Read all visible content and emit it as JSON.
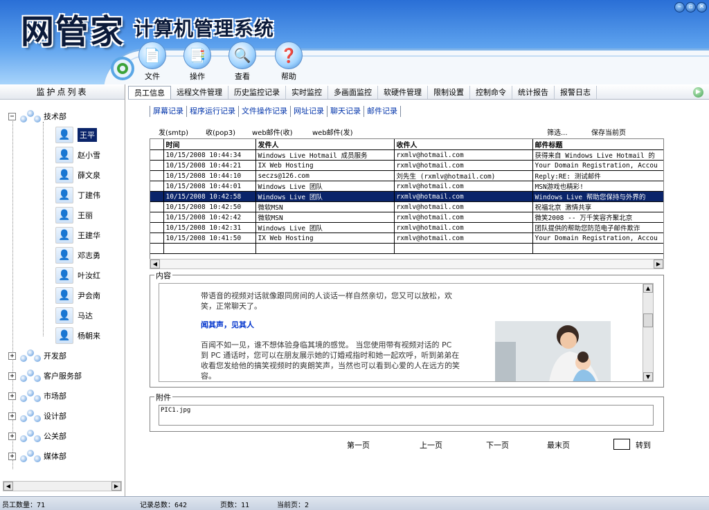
{
  "app": {
    "title": "网管家",
    "subtitle": "计算机管理系统"
  },
  "window_controls": [
    "minimize-icon",
    "restore-icon",
    "close-icon"
  ],
  "toolbar": [
    {
      "label": "文件",
      "icon": "file-icon"
    },
    {
      "label": "操作",
      "icon": "operate-icon"
    },
    {
      "label": "查看",
      "icon": "view-icon"
    },
    {
      "label": "帮助",
      "icon": "help-icon"
    }
  ],
  "left_panel": {
    "title": "监护点列表",
    "expanded_group": "技术部",
    "members": [
      "王平",
      "赵小雪",
      "薛文泉",
      "丁建伟",
      "王丽",
      "王建华",
      "邓志勇",
      "叶汝红",
      "尹会南",
      "马达",
      "杨朝来"
    ],
    "selected_member": "王平",
    "other_groups": [
      "开发部",
      "客户服务部",
      "市场部",
      "设计部",
      "公关部",
      "媒体部"
    ]
  },
  "tabs": [
    "员工信息",
    "远程文件管理",
    "历史监控记录",
    "实时监控",
    "多画面监控",
    "软硬件管理",
    "限制设置",
    "控制命令",
    "统计报告",
    "报警日志"
  ],
  "active_tab": "员工信息",
  "subtabs": [
    "屏幕记录",
    "程序运行记录",
    "文件操作记录",
    "网址记录",
    "聊天记录",
    "邮件记录"
  ],
  "mail_types": [
    "发(smtp)",
    "收(pop3)",
    "web邮件(收)",
    "web邮件(发)"
  ],
  "actions": {
    "filter": "筛选...",
    "save": "保存当前页"
  },
  "grid": {
    "columns": [
      "时间",
      "发件人",
      "收件人",
      "邮件标题"
    ],
    "rows": [
      [
        "10/15/2008 10:44:34",
        "Windows Live Hotmail 成员服务",
        "rxmlv@hotmail.com",
        "获得来自 Windows Live Hotmail 的"
      ],
      [
        "10/15/2008 10:44:21",
        "IX Web Hosting",
        "rxmlv@hotmail.com",
        "Your Domain Registration, Accou"
      ],
      [
        "10/15/2008 10:44:10",
        "seczs@126.com",
        "刘先生 (rxmlv@hotmail.com)",
        "Reply:RE: 测试邮件"
      ],
      [
        "10/15/2008 10:44:01",
        "Windows Live 团队",
        "rxmlv@hotmail.com",
        "MSN游戏也精彩!"
      ],
      [
        "10/15/2008 10:42:58",
        "Windows Live 团队",
        "rxmlv@hotmail.com",
        "Windows Live 帮助您保持与外界的"
      ],
      [
        "10/15/2008 10:42:50",
        "微软MSN",
        "rxmlv@hotmail.com",
        "祝福北京 激情共享"
      ],
      [
        "10/15/2008 10:42:42",
        "微软MSN",
        "rxmlv@hotmail.com",
        "微笑2008 -- 万千笑容齐聚北京"
      ],
      [
        "10/15/2008 10:42:31",
        "Windows Live 团队",
        "rxmlv@hotmail.com",
        "团队提供的帮助您防范电子邮件欺诈"
      ],
      [
        "10/15/2008 10:41:50",
        "IX Web Hosting",
        "rxmlv@hotmail.com",
        "Your Domain Registration, Accou"
      ]
    ],
    "selected_row": 4
  },
  "content": {
    "legend": "内容",
    "para1": "带语音的视频对话就像跟同房间的人谈话一样自然亲切，您又可以放松，欢笑，正常聊天了。",
    "heading": "闻其声，见其人",
    "para2": "百闻不如一见，谁不想体验身临其境的感觉。 当您使用带有视频对话的 PC 到 PC 通话时，您可以在朋友展示她的订婚戒指时和她一起欢呼，听到弟弟在收看您发给他的搞笑视频时的爽朗笑声，当然也可以看到心爱的人在远方的笑容。"
  },
  "attachment": {
    "legend": "附件",
    "file": "PIC1.jpg"
  },
  "pager": {
    "first": "第一页",
    "prev": "上一页",
    "next": "下一页",
    "last": "最末页",
    "goto": "转到"
  },
  "status": {
    "employees": "员工数量：71",
    "records": "记录总数：642",
    "pages": "页数：11",
    "current": "当前页：2"
  }
}
